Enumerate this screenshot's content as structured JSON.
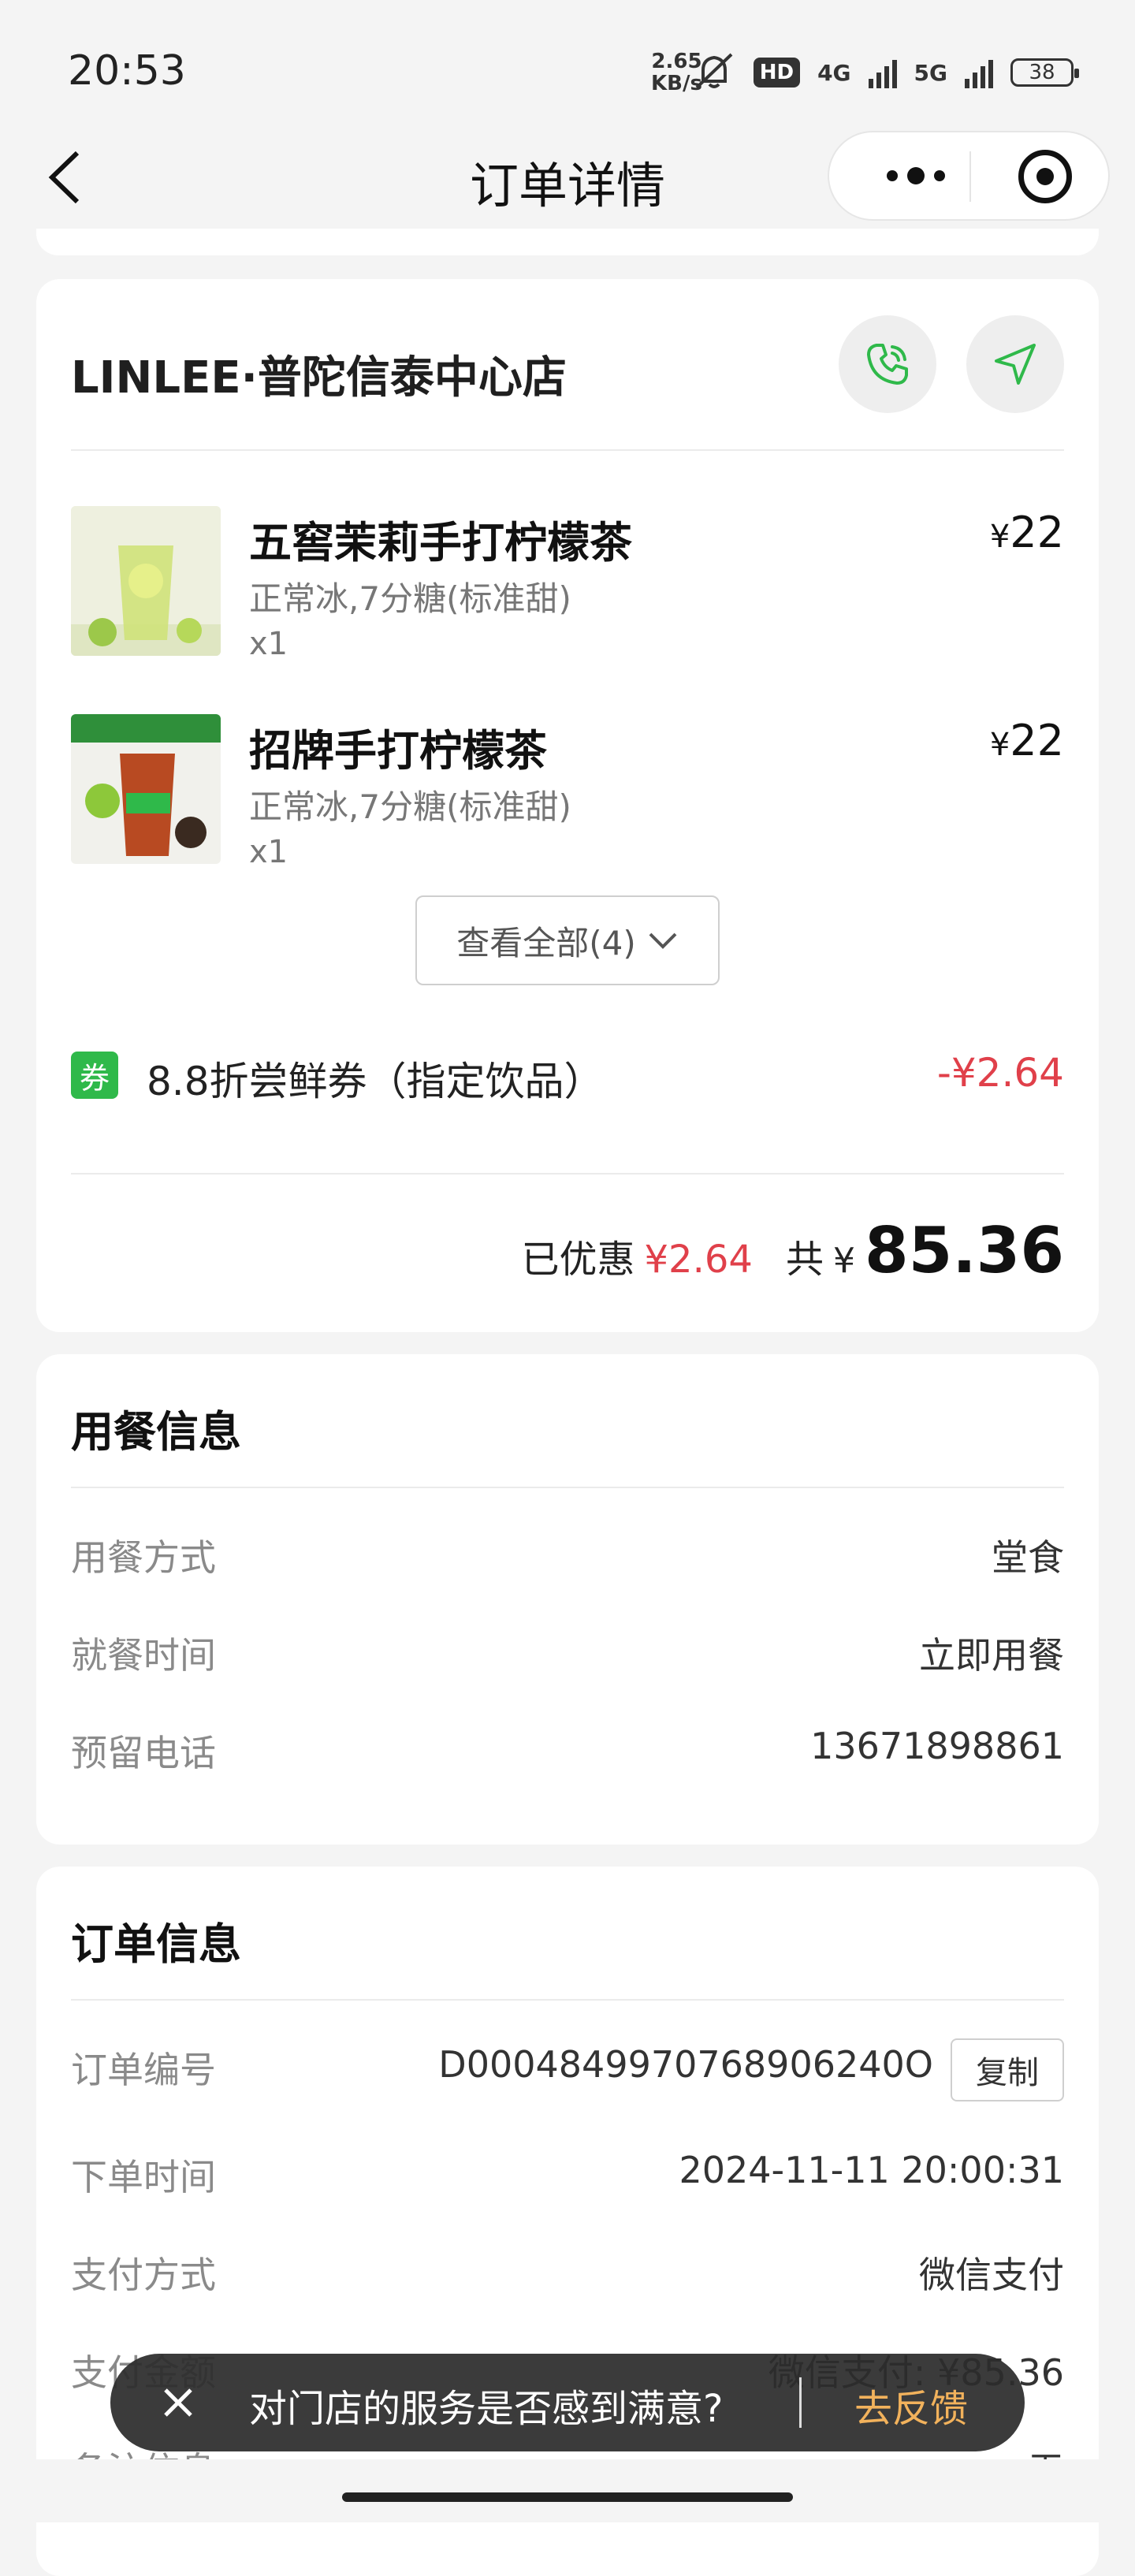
{
  "status_bar": {
    "time": "20:53",
    "net_speed_value": "2.65",
    "net_speed_unit": "KB/s",
    "hd": "HD",
    "sim1": "4G",
    "sim2": "5G",
    "battery": "38"
  },
  "nav": {
    "title": "订单详情"
  },
  "store": {
    "name": "LINLEE·普陀信泰中心店",
    "colors": {
      "accent_green": "#2fb94a",
      "discount_red": "#e0404a"
    }
  },
  "items": [
    {
      "name": "五窖茉莉手打柠檬茶",
      "spec": "正常冰,7分糖(标准甜)",
      "qty": "x1",
      "currency": "¥",
      "price": "22"
    },
    {
      "name": "招牌手打柠檬茶",
      "spec": "正常冰,7分糖(标准甜)",
      "qty": "x1",
      "currency": "¥",
      "price": "22"
    }
  ],
  "view_all_label": "查看全部(4)",
  "coupon": {
    "tag": "券",
    "text": "8.8折尝鲜券（指定饮品）",
    "amount": "-¥2.64"
  },
  "summary": {
    "discount_label": "已优惠",
    "discount_value": "¥2.64",
    "total_label": "共",
    "currency": "¥",
    "total_value": "85.36"
  },
  "dining": {
    "title": "用餐信息",
    "rows": [
      {
        "label": "用餐方式",
        "value": "堂食"
      },
      {
        "label": "就餐时间",
        "value": "立即用餐"
      },
      {
        "label": "预留电话",
        "value": "13671898861"
      }
    ]
  },
  "order": {
    "title": "订单信息",
    "order_no_label": "订单编号",
    "order_no": "D0004849970768906240O",
    "copy_label": "复制",
    "rows": [
      {
        "label": "下单时间",
        "value": "2024-11-11 20:00:31"
      },
      {
        "label": "支付方式",
        "value": "微信支付"
      },
      {
        "label": "支付金额",
        "value": "微信支付: ¥85.36"
      },
      {
        "label": "备注信息",
        "value": "无"
      }
    ]
  },
  "toast": {
    "text": "对门店的服务是否感到满意?",
    "action": "去反馈"
  }
}
